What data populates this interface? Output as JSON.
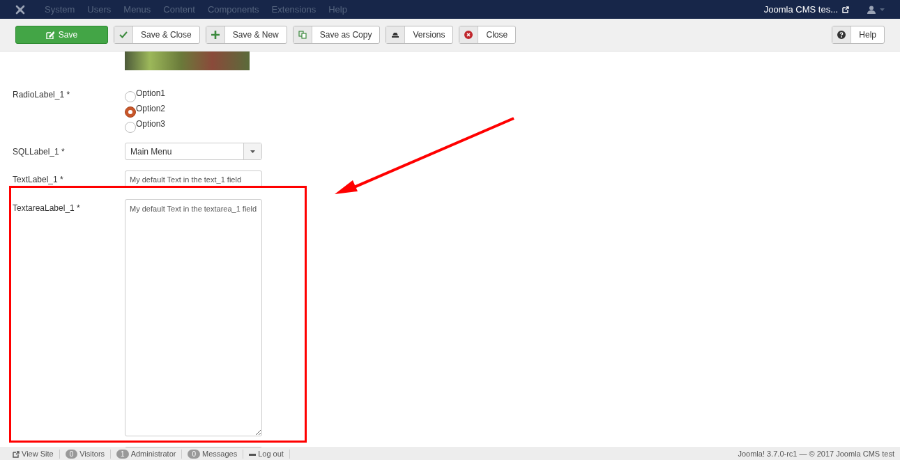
{
  "navbar": {
    "menu": [
      {
        "label": "System",
        "disabled": true
      },
      {
        "label": "Users",
        "disabled": true
      },
      {
        "label": "Menus",
        "disabled": true
      },
      {
        "label": "Content",
        "disabled": true
      },
      {
        "label": "Components",
        "disabled": true
      },
      {
        "label": "Extensions",
        "disabled": true
      },
      {
        "label": "Help",
        "disabled": true
      }
    ],
    "site_link": "Joomla CMS tes..."
  },
  "toolbar": {
    "buttons": [
      {
        "label": "Save",
        "kind": "primary"
      },
      {
        "label": "Save & Close",
        "kind": "check"
      },
      {
        "label": "Save & New",
        "kind": "plus"
      },
      {
        "label": "Save as Copy",
        "kind": "copy"
      },
      {
        "label": "Versions",
        "kind": "versions"
      },
      {
        "label": "Close",
        "kind": "close"
      }
    ],
    "help": {
      "label": "Help",
      "kind": "help"
    }
  },
  "fields": [
    {
      "kind": "image"
    },
    {
      "kind": "radio",
      "label": "RadioLabel_1 *",
      "options": [
        {
          "label": "Option1",
          "selected": false
        },
        {
          "label": "Option2",
          "selected": true
        },
        {
          "label": "Option3",
          "selected": false
        }
      ]
    },
    {
      "kind": "select",
      "label": "SQLLabel_1 *",
      "value": "Main Menu"
    },
    {
      "kind": "text",
      "label": "TextLabel_1 *",
      "value": "My default Text in the text_1 field"
    },
    {
      "kind": "textarea",
      "label": "TextareaLabel_1 *",
      "value": "My default Text in the textarea_1 field"
    },
    {
      "kind": "partial"
    }
  ],
  "status_bar": {
    "items": [
      {
        "kind": "link",
        "label": "View Site"
      },
      {
        "kind": "count",
        "count": "0",
        "label": "Visitors"
      },
      {
        "kind": "count",
        "count": "1",
        "label": "Administrator"
      },
      {
        "kind": "count",
        "count": "0",
        "label": "Messages"
      },
      {
        "kind": "logout",
        "label": "Log out"
      }
    ],
    "copyright": "Joomla! 3.7.0-rc1  —  © 2017 Joomla CMS test"
  }
}
